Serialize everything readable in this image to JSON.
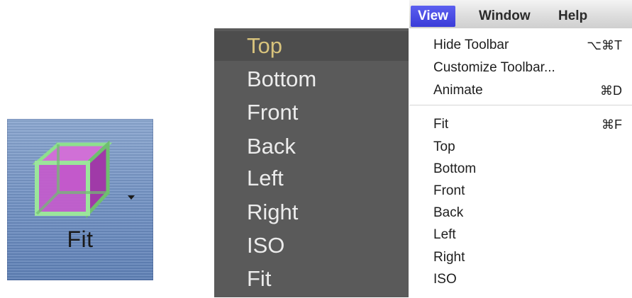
{
  "toolbar_button": {
    "label": "Fit",
    "icon": "cube-icon",
    "has_dropdown": true
  },
  "popup_menu": {
    "items": [
      "Top",
      "Bottom",
      "Front",
      "Back",
      "Left",
      "Right",
      "ISO",
      "Fit"
    ],
    "highlighted": "Top"
  },
  "menu_bar": {
    "menus": [
      "View",
      "Window",
      "Help"
    ],
    "active": "View"
  },
  "view_menu": {
    "group1": [
      {
        "label": "Hide Toolbar",
        "shortcut": "⌥⌘T"
      },
      {
        "label": "Customize Toolbar...",
        "shortcut": ""
      },
      {
        "label": "Animate",
        "shortcut": "⌘D"
      }
    ],
    "group2": [
      {
        "label": "Fit",
        "shortcut": "⌘F"
      },
      {
        "label": "Top",
        "shortcut": ""
      },
      {
        "label": "Bottom",
        "shortcut": ""
      },
      {
        "label": "Front",
        "shortcut": ""
      },
      {
        "label": "Back",
        "shortcut": ""
      },
      {
        "label": "Left",
        "shortcut": ""
      },
      {
        "label": "Right",
        "shortcut": ""
      },
      {
        "label": "ISO",
        "shortcut": ""
      }
    ]
  },
  "colors": {
    "menu_highlight": "#3a3cd8",
    "popup_bg": "#5a5a5a",
    "popup_highlight_text": "#d8c37c",
    "button_bg": "#6f8fc1",
    "cube_face": "#c04ec8",
    "cube_edge": "#7fd27f"
  }
}
